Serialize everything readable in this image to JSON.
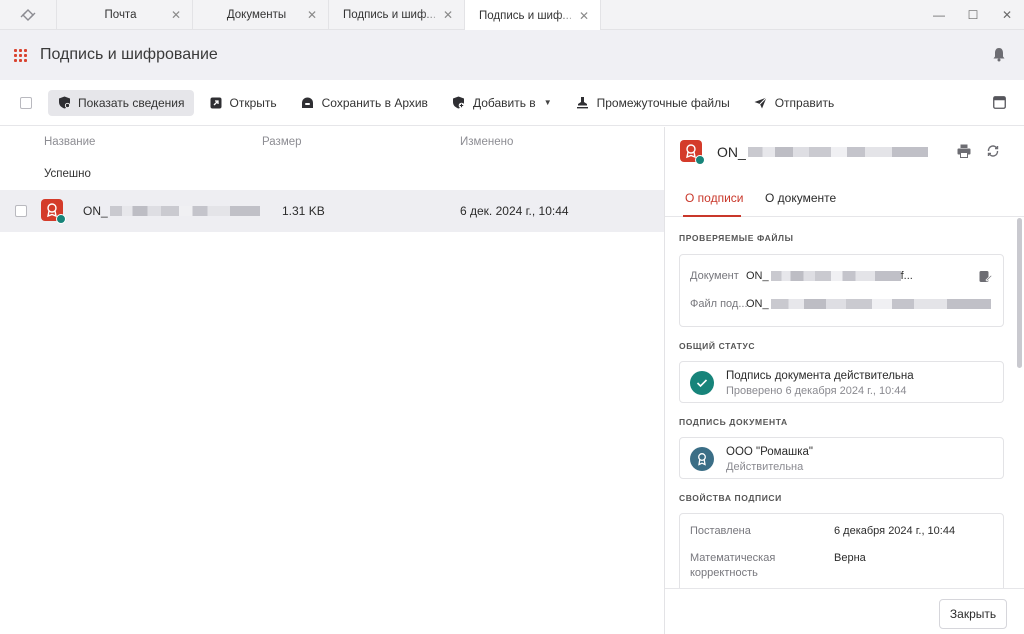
{
  "tabs": [
    {
      "label": "Почта"
    },
    {
      "label": "Документы"
    },
    {
      "label": "Подпись и шиф..."
    },
    {
      "label": "Подпись и шиф..."
    }
  ],
  "header": {
    "title": "Подпись и шифрование",
    "accent": "#d9432f"
  },
  "toolbar": {
    "show_details": "Показать сведения",
    "open": "Открыть",
    "save_archive": "Сохранить в Архив",
    "add_to": "Добавить в",
    "intermediate_files": "Промежуточные файлы",
    "send": "Отправить"
  },
  "list": {
    "columns": {
      "name": "Название",
      "size": "Размер",
      "modified": "Изменено"
    },
    "group": "Успешно",
    "rows": [
      {
        "name_prefix": "ON_",
        "size": "1.31 KB",
        "modified": "6 дек. 2024 г., 10:44"
      }
    ]
  },
  "panel": {
    "title_prefix": "ON_",
    "tabs": {
      "signature": "О подписи",
      "document": "О документе"
    },
    "sections": {
      "files": "ПРОВЕРЯЕМЫЕ ФАЙЛЫ",
      "status": "ОБЩИЙ СТАТУС",
      "doc_signature": "ПОДПИСЬ ДОКУМЕНТА",
      "properties": "СВОЙСТВА ПОДПИСИ"
    },
    "files": {
      "document_label": "Документ",
      "document_value": "ON_",
      "document_suffix": "f...",
      "sigfile_label": "Файл под...",
      "sigfile_value": "ON_"
    },
    "status": {
      "main": "Подпись документа действительна",
      "sub": "Проверено 6 декабря 2024 г., 10:44",
      "color": "#17847a"
    },
    "signer": {
      "name": "ООО \"Ромашка\"",
      "state": "Действительна",
      "color": "#3b6e86"
    },
    "properties": {
      "placed_label": "Поставлена",
      "placed_value": "6 декабря 2024 г., 10:44",
      "math_label_1": "Математическая",
      "math_label_2": "корректность",
      "math_value": "Верна"
    },
    "close": "Закрыть"
  }
}
